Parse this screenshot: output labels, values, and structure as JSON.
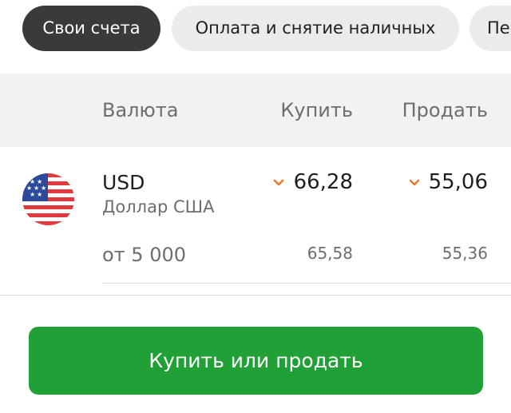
{
  "tabs": [
    {
      "label": "Свои счета",
      "active": true
    },
    {
      "label": "Оплата и снятие наличных",
      "active": false
    },
    {
      "label": "Пе",
      "active": false
    }
  ],
  "table": {
    "headers": {
      "currency": "Валюта",
      "buy": "Купить",
      "sell": "Продать"
    },
    "rows": [
      {
        "flag_icon": "us-flag-icon",
        "code": "USD",
        "name": "Доллар США",
        "buy": "66,28",
        "sell": "55,06",
        "buy_trend_icon": "chevron-down-icon",
        "sell_trend_icon": "chevron-down-icon",
        "tier_label": "от 5 000",
        "tier_buy": "65,58",
        "tier_sell": "55,36"
      }
    ]
  },
  "cta": {
    "label": "Купить или продать"
  },
  "colors": {
    "active_tab": "#3a3a3d",
    "tab": "#ebebeb",
    "header_bg": "#f2f2f2",
    "accent_green": "#21a038",
    "trend_orange": "#e8782c",
    "muted_text": "#6d6d72"
  }
}
